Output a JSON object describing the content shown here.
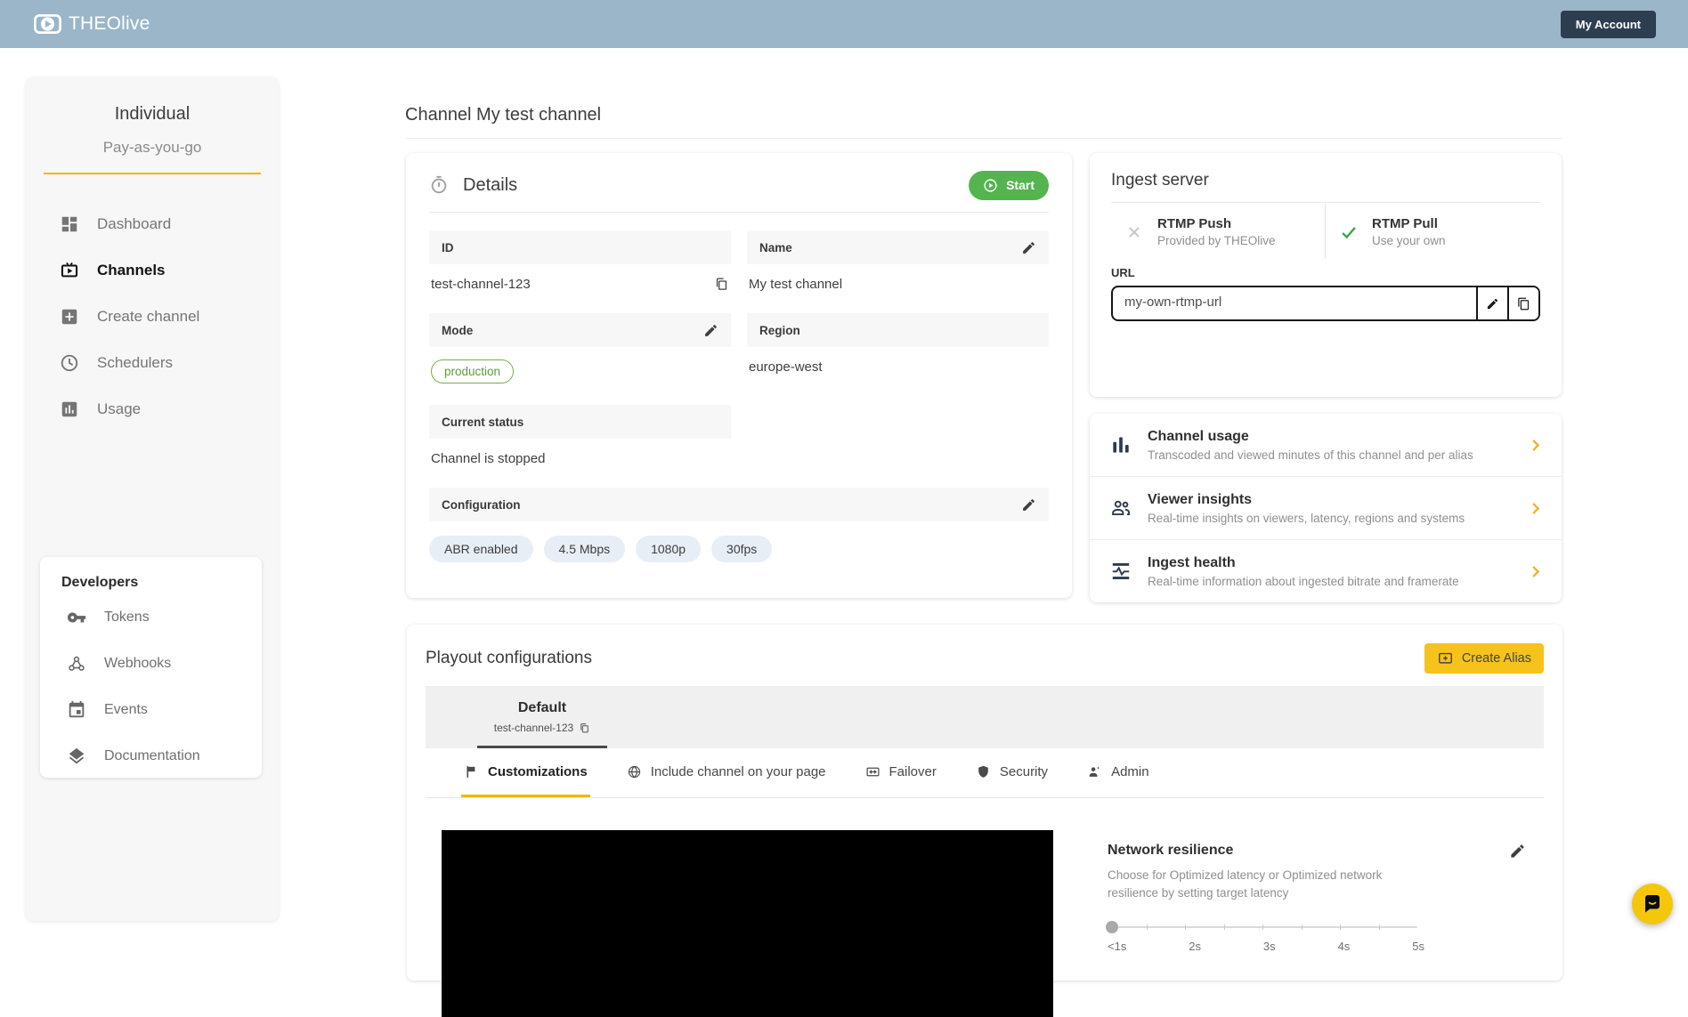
{
  "colors": {
    "topbar_bg": "#9ab6c8",
    "navy": "#2d3e50",
    "accent_yellow": "#f2b50d",
    "button_yellow": "#f6c21c",
    "green": "#54b44e",
    "pill_green_text": "#5d9c39"
  },
  "topbar": {
    "brand": "THEOlive",
    "account_button": "My Account"
  },
  "sidebar": {
    "plan_name": "Individual",
    "plan_type": "Pay-as-you-go",
    "items": [
      {
        "label": "Dashboard"
      },
      {
        "label": "Channels"
      },
      {
        "label": "Create channel"
      },
      {
        "label": "Schedulers"
      },
      {
        "label": "Usage"
      }
    ],
    "developers": {
      "title": "Developers",
      "items": [
        {
          "label": "Tokens"
        },
        {
          "label": "Webhooks"
        },
        {
          "label": "Events"
        },
        {
          "label": "Documentation"
        }
      ]
    }
  },
  "page": {
    "title": "Channel My test channel"
  },
  "details": {
    "title": "Details",
    "start_button": "Start",
    "id_label": "ID",
    "id_value": "test-channel-123",
    "name_label": "Name",
    "name_value": "My test channel",
    "mode_label": "Mode",
    "mode_value": "production",
    "region_label": "Region",
    "region_value": "europe-west",
    "status_label": "Current status",
    "status_value": "Channel is stopped",
    "config_label": "Configuration",
    "config_tags": [
      "ABR enabled",
      "4.5 Mbps",
      "1080p",
      "30fps"
    ]
  },
  "ingest": {
    "title": "Ingest server",
    "push_title": "RTMP Push",
    "push_subtitle": "Provided by THEOlive",
    "pull_title": "RTMP Pull",
    "pull_subtitle": "Use your own",
    "url_label": "URL",
    "url_value": "my-own-rtmp-url"
  },
  "insights": {
    "items": [
      {
        "title": "Channel usage",
        "description": "Transcoded and viewed minutes of this channel and per alias"
      },
      {
        "title": "Viewer insights",
        "description": "Real-time insights on viewers, latency, regions and systems"
      },
      {
        "title": "Ingest health",
        "description": "Real-time information about ingested bitrate and framerate"
      }
    ]
  },
  "playout": {
    "title": "Playout configurations",
    "create_alias_button": "Create Alias",
    "default_tab": {
      "name": "Default",
      "channel_id": "test-channel-123"
    },
    "tabs": [
      {
        "label": "Customizations"
      },
      {
        "label": "Include channel on your page"
      },
      {
        "label": "Failover"
      },
      {
        "label": "Security"
      },
      {
        "label": "Admin"
      }
    ],
    "network_resilience": {
      "title": "Network resilience",
      "description": "Choose for Optimized latency or Optimized network resilience by setting target latency",
      "slider_labels": [
        "<1s",
        "2s",
        "3s",
        "4s",
        "5s"
      ]
    }
  }
}
